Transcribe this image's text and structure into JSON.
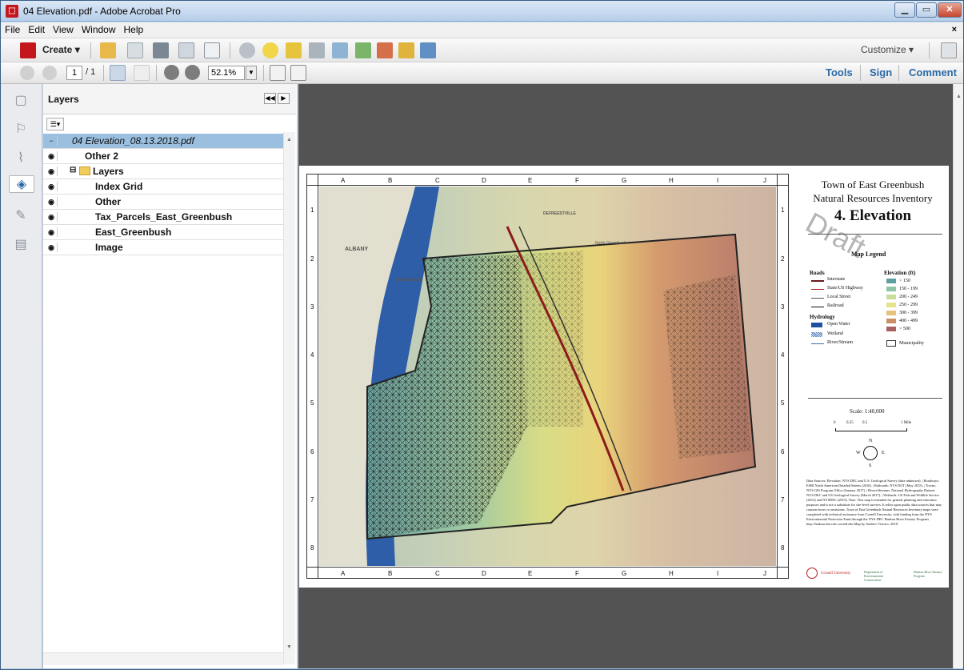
{
  "window": {
    "title": "04 Elevation.pdf - Adobe Acrobat Pro",
    "app_icon": "acrobat-icon",
    "controls": [
      "minimize",
      "maximize",
      "close"
    ]
  },
  "menu": {
    "items": [
      "File",
      "Edit",
      "View",
      "Window",
      "Help"
    ],
    "close_glyph": "×"
  },
  "toolbar": {
    "create_label": "Create",
    "customize_label": "Customize",
    "icons": [
      "create-icon",
      "open-icon",
      "save-icon",
      "print-icon",
      "edit-icon",
      "email-icon",
      "settings-icon",
      "comment-icon",
      "sign-icon",
      "combine-icon",
      "export-icon",
      "protect-icon",
      "form-icon",
      "attach-icon",
      "scan-icon"
    ]
  },
  "nav": {
    "page_current": "1",
    "page_total": "/ 1",
    "zoom": "52.1%"
  },
  "right_links": {
    "tools": "Tools",
    "sign": "Sign",
    "comment": "Comment"
  },
  "layers_panel": {
    "title": "Layers",
    "rows": [
      {
        "name": "04 Elevation_08.13.2018.pdf",
        "visible": false,
        "selected": true
      },
      {
        "name": "Other 2",
        "visible": true
      },
      {
        "name": "Layers",
        "visible": true
      },
      {
        "name": "Index Grid",
        "visible": true
      },
      {
        "name": "Other",
        "visible": true
      },
      {
        "name": "Tax_Parcels_East_Greenbush",
        "visible": true
      },
      {
        "name": "East_Greenbush",
        "visible": true
      },
      {
        "name": "Image",
        "visible": true
      }
    ]
  },
  "map": {
    "columns": [
      "A",
      "B",
      "C",
      "D",
      "E",
      "F",
      "G",
      "H",
      "I",
      "J"
    ],
    "rows": [
      "1",
      "2",
      "3",
      "4",
      "5",
      "6",
      "7",
      "8"
    ],
    "place_labels": [
      "ALBANY",
      "RENSSELAER",
      "DEFREESTVILLE",
      "North Greenbush"
    ]
  },
  "legend": {
    "title_line1": "Town of East Greenbush",
    "title_line2": "Natural Resources Inventory",
    "title_line3": "4. Elevation",
    "watermark": "Draft",
    "map_legend": "Map Legend",
    "roads_heading": "Roads",
    "roads": [
      "Interstate",
      "State/US Highway",
      "Local Street",
      "Railroad"
    ],
    "hydrology_heading": "Hydrology",
    "hydrology": [
      "Open Water",
      "Wetland",
      "River/Stream"
    ],
    "elevation_heading": "Elevation (ft)",
    "elevation_classes": [
      "< 150",
      "150 - 199",
      "200 - 249",
      "250 - 299",
      "300 - 399",
      "400 - 499",
      "> 500"
    ],
    "elevation_colors": [
      "#5f9ea0",
      "#8fc4a8",
      "#c8dd9a",
      "#e6e38a",
      "#e7c27c",
      "#c98f66",
      "#a86060"
    ],
    "municipality": "Municipality",
    "scale": "Scale: 1:40,000",
    "scale_ticks": [
      "0",
      "0.25",
      "0.5",
      "1 Mile"
    ],
    "compass": [
      "N",
      "E",
      "S",
      "W"
    ],
    "sources": "Data Sources: Elevation: NYS DEC and U.S. Geological Survey (date unknown). | Roadways: ESRI North American Detailed Streets (2010). | Railroads: NYS DOT (May 2015). | Towns: NYS GIS Program Office (January 2017). | Rivers/Streams: National Hydrography Dataset: NYS DEC and US Geological Survey (March 2017). | Wetlands: US Fish and Wildlife Service (2012) and NYSDEC (2015). Note: This map is intended for general planning and education purposes and is not a substitute for site-level surveys. It relies upon public data sources that may contain errors or omissions. Town of East Greenbush Natural Resources Inventory maps were completed with technical assistance from Cornell University, with funding from the NYS Environmental Protection Fund through the NYS DEC Hudson River Estuary Program. http://hudson.dnr.cals.cornell.edu Map by Andrew Vercaro, 2018.",
    "logos": [
      "Cornell University",
      "Department of Environmental Conservation",
      "Hudson River Estuary Program"
    ]
  }
}
